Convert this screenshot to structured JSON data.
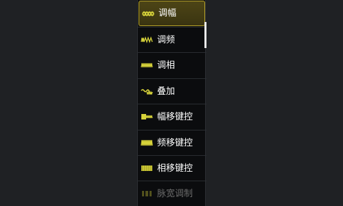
{
  "menu": {
    "items": [
      {
        "label": "调幅",
        "icon": "am-icon",
        "state": "selected"
      },
      {
        "label": "调频",
        "icon": "fm-icon",
        "state": "normal"
      },
      {
        "label": "调相",
        "icon": "pm-icon",
        "state": "normal"
      },
      {
        "label": "叠加",
        "icon": "sum-icon",
        "state": "normal"
      },
      {
        "label": "幅移键控",
        "icon": "ask-icon",
        "state": "normal"
      },
      {
        "label": "频移键控",
        "icon": "fsk-icon",
        "state": "normal"
      },
      {
        "label": "相移键控",
        "icon": "psk-icon",
        "state": "normal"
      },
      {
        "label": "脉宽调制",
        "icon": "pwm-icon",
        "state": "disabled"
      }
    ]
  },
  "colors": {
    "background": "#1f2124",
    "menu_background": "#0b0c0e",
    "accent": "#b9a52a",
    "icon_yellow": "#d6d23a",
    "text": "#ffffff",
    "text_disabled": "#6b6b6b"
  }
}
